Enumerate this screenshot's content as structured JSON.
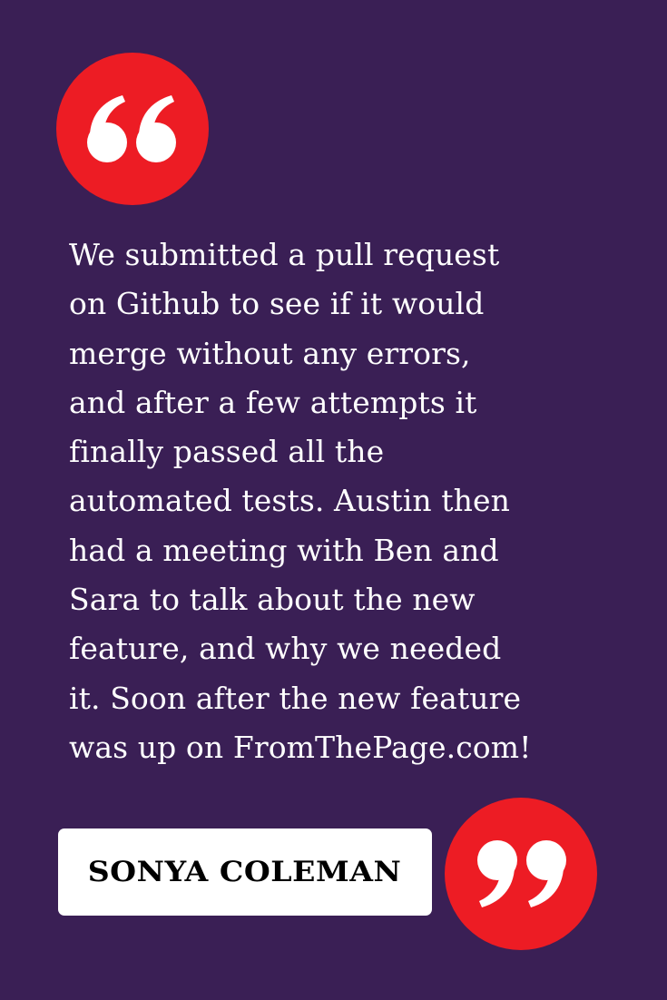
{
  "quote": {
    "lines": [
      "We submitted a pull request",
      "on Github to see if it would",
      "merge without any errors,",
      "and after a few attempts it",
      "finally passed all the",
      "automated tests. Austin then",
      "had a meeting with Ben and",
      "Sara to talk about the new",
      "feature, and why we needed",
      "it. Soon after the new feature",
      "was up on FromThePage.com!"
    ]
  },
  "author": {
    "name": "SONYA COLEMAN"
  },
  "icons": {
    "open": "open-quote-icon",
    "close": "close-quote-icon"
  },
  "colors": {
    "background": "#3a1f55",
    "accent": "#ed1c24",
    "text": "#ffffff",
    "name_box": "#ffffff",
    "name_text": "#000000"
  }
}
